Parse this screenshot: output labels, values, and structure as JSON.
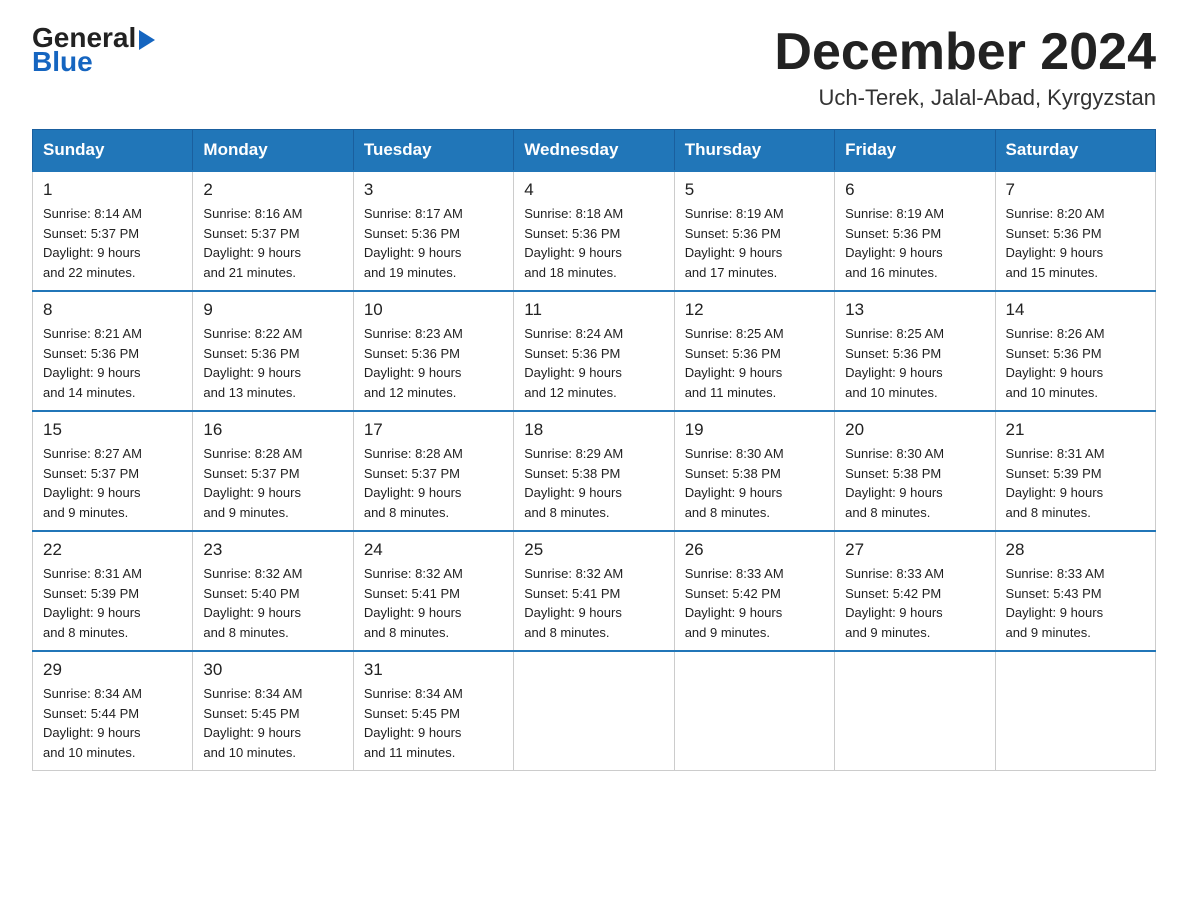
{
  "header": {
    "logo_general": "General",
    "logo_blue": "Blue",
    "main_title": "December 2024",
    "subtitle": "Uch-Terek, Jalal-Abad, Kyrgyzstan"
  },
  "days_of_week": [
    "Sunday",
    "Monday",
    "Tuesday",
    "Wednesday",
    "Thursday",
    "Friday",
    "Saturday"
  ],
  "weeks": [
    {
      "days": [
        {
          "num": "1",
          "sunrise": "8:14 AM",
          "sunset": "5:37 PM",
          "daylight": "9 hours and 22 minutes."
        },
        {
          "num": "2",
          "sunrise": "8:16 AM",
          "sunset": "5:37 PM",
          "daylight": "9 hours and 21 minutes."
        },
        {
          "num": "3",
          "sunrise": "8:17 AM",
          "sunset": "5:36 PM",
          "daylight": "9 hours and 19 minutes."
        },
        {
          "num": "4",
          "sunrise": "8:18 AM",
          "sunset": "5:36 PM",
          "daylight": "9 hours and 18 minutes."
        },
        {
          "num": "5",
          "sunrise": "8:19 AM",
          "sunset": "5:36 PM",
          "daylight": "9 hours and 17 minutes."
        },
        {
          "num": "6",
          "sunrise": "8:19 AM",
          "sunset": "5:36 PM",
          "daylight": "9 hours and 16 minutes."
        },
        {
          "num": "7",
          "sunrise": "8:20 AM",
          "sunset": "5:36 PM",
          "daylight": "9 hours and 15 minutes."
        }
      ]
    },
    {
      "days": [
        {
          "num": "8",
          "sunrise": "8:21 AM",
          "sunset": "5:36 PM",
          "daylight": "9 hours and 14 minutes."
        },
        {
          "num": "9",
          "sunrise": "8:22 AM",
          "sunset": "5:36 PM",
          "daylight": "9 hours and 13 minutes."
        },
        {
          "num": "10",
          "sunrise": "8:23 AM",
          "sunset": "5:36 PM",
          "daylight": "9 hours and 12 minutes."
        },
        {
          "num": "11",
          "sunrise": "8:24 AM",
          "sunset": "5:36 PM",
          "daylight": "9 hours and 12 minutes."
        },
        {
          "num": "12",
          "sunrise": "8:25 AM",
          "sunset": "5:36 PM",
          "daylight": "9 hours and 11 minutes."
        },
        {
          "num": "13",
          "sunrise": "8:25 AM",
          "sunset": "5:36 PM",
          "daylight": "9 hours and 10 minutes."
        },
        {
          "num": "14",
          "sunrise": "8:26 AM",
          "sunset": "5:36 PM",
          "daylight": "9 hours and 10 minutes."
        }
      ]
    },
    {
      "days": [
        {
          "num": "15",
          "sunrise": "8:27 AM",
          "sunset": "5:37 PM",
          "daylight": "9 hours and 9 minutes."
        },
        {
          "num": "16",
          "sunrise": "8:28 AM",
          "sunset": "5:37 PM",
          "daylight": "9 hours and 9 minutes."
        },
        {
          "num": "17",
          "sunrise": "8:28 AM",
          "sunset": "5:37 PM",
          "daylight": "9 hours and 8 minutes."
        },
        {
          "num": "18",
          "sunrise": "8:29 AM",
          "sunset": "5:38 PM",
          "daylight": "9 hours and 8 minutes."
        },
        {
          "num": "19",
          "sunrise": "8:30 AM",
          "sunset": "5:38 PM",
          "daylight": "9 hours and 8 minutes."
        },
        {
          "num": "20",
          "sunrise": "8:30 AM",
          "sunset": "5:38 PM",
          "daylight": "9 hours and 8 minutes."
        },
        {
          "num": "21",
          "sunrise": "8:31 AM",
          "sunset": "5:39 PM",
          "daylight": "9 hours and 8 minutes."
        }
      ]
    },
    {
      "days": [
        {
          "num": "22",
          "sunrise": "8:31 AM",
          "sunset": "5:39 PM",
          "daylight": "9 hours and 8 minutes."
        },
        {
          "num": "23",
          "sunrise": "8:32 AM",
          "sunset": "5:40 PM",
          "daylight": "9 hours and 8 minutes."
        },
        {
          "num": "24",
          "sunrise": "8:32 AM",
          "sunset": "5:41 PM",
          "daylight": "9 hours and 8 minutes."
        },
        {
          "num": "25",
          "sunrise": "8:32 AM",
          "sunset": "5:41 PM",
          "daylight": "9 hours and 8 minutes."
        },
        {
          "num": "26",
          "sunrise": "8:33 AM",
          "sunset": "5:42 PM",
          "daylight": "9 hours and 9 minutes."
        },
        {
          "num": "27",
          "sunrise": "8:33 AM",
          "sunset": "5:42 PM",
          "daylight": "9 hours and 9 minutes."
        },
        {
          "num": "28",
          "sunrise": "8:33 AM",
          "sunset": "5:43 PM",
          "daylight": "9 hours and 9 minutes."
        }
      ]
    },
    {
      "days": [
        {
          "num": "29",
          "sunrise": "8:34 AM",
          "sunset": "5:44 PM",
          "daylight": "9 hours and 10 minutes."
        },
        {
          "num": "30",
          "sunrise": "8:34 AM",
          "sunset": "5:45 PM",
          "daylight": "9 hours and 10 minutes."
        },
        {
          "num": "31",
          "sunrise": "8:34 AM",
          "sunset": "5:45 PM",
          "daylight": "9 hours and 11 minutes."
        },
        null,
        null,
        null,
        null
      ]
    }
  ],
  "cell_labels": {
    "sunrise_prefix": "Sunrise: ",
    "sunset_prefix": "Sunset: ",
    "daylight_prefix": "Daylight: "
  }
}
